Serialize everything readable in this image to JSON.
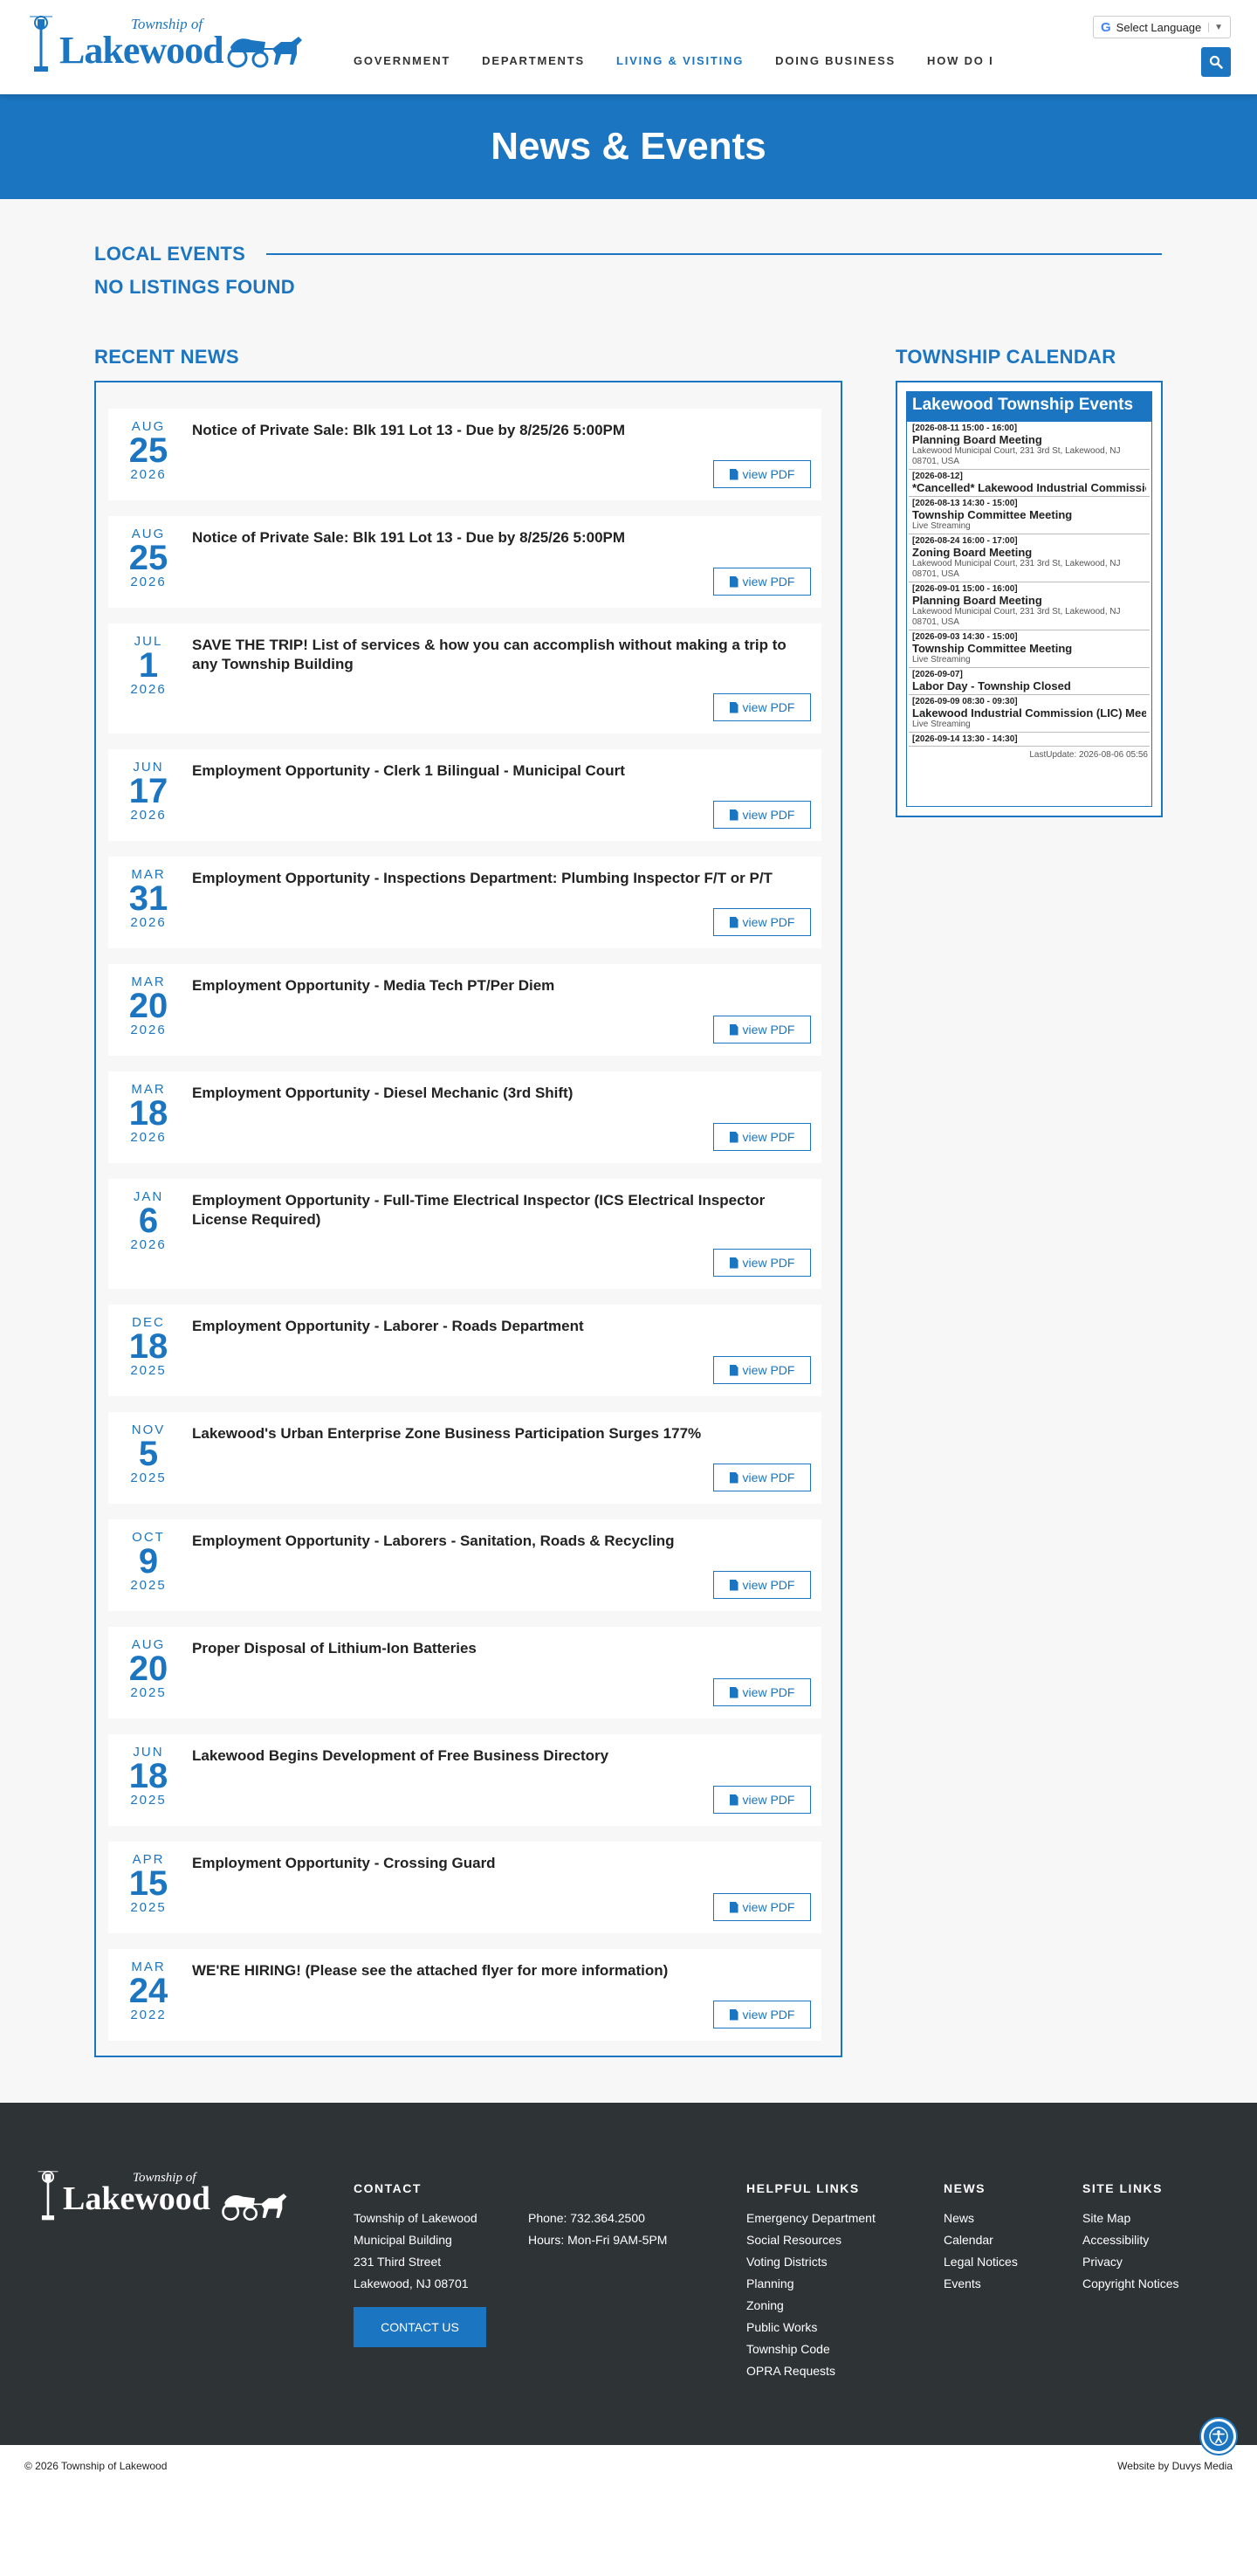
{
  "header": {
    "logo_small": "Township of",
    "logo_name": "Lakewood",
    "nav": [
      "GOVERNMENT",
      "DEPARTMENTS",
      "LIVING & VISITING",
      "DOING BUSINESS",
      "HOW DO I"
    ],
    "active_nav": "LIVING & VISITING",
    "language_label": "Select Language",
    "language_g": "G",
    "language_arrow": "▼"
  },
  "banner": {
    "title": "News & Events"
  },
  "local_events": {
    "title": "LOCAL EVENTS",
    "empty": "NO LISTINGS FOUND"
  },
  "recent_news": {
    "title": "RECENT NEWS",
    "button_label": "view PDF",
    "items": [
      {
        "mon": "AUG",
        "day": "25",
        "yr": "2026",
        "title": "Notice of Private Sale: Blk 191 Lot 13 - Due by 8/25/26 5:00PM"
      },
      {
        "mon": "AUG",
        "day": "25",
        "yr": "2026",
        "title": "Notice of Private Sale: Blk 191 Lot 13 - Due by 8/25/26 5:00PM"
      },
      {
        "mon": "JUL",
        "day": "1",
        "yr": "2026",
        "title": "SAVE THE TRIP! List of services & how you can accomplish without making a trip to any Township Building"
      },
      {
        "mon": "JUN",
        "day": "17",
        "yr": "2026",
        "title": "Employment Opportunity - Clerk 1 Bilingual - Municipal Court"
      },
      {
        "mon": "MAR",
        "day": "31",
        "yr": "2026",
        "title": "Employment Opportunity - Inspections Department: Plumbing Inspector F/T or P/T"
      },
      {
        "mon": "MAR",
        "day": "20",
        "yr": "2026",
        "title": "Employment Opportunity - Media Tech PT/Per Diem"
      },
      {
        "mon": "MAR",
        "day": "18",
        "yr": "2026",
        "title": "Employment Opportunity - Diesel Mechanic (3rd Shift)"
      },
      {
        "mon": "JAN",
        "day": "6",
        "yr": "2026",
        "title": "Employment Opportunity - Full-Time Electrical Inspector (ICS Electrical Inspector License Required)"
      },
      {
        "mon": "DEC",
        "day": "18",
        "yr": "2025",
        "title": "Employment Opportunity - Laborer - Roads Department"
      },
      {
        "mon": "NOV",
        "day": "5",
        "yr": "2025",
        "title": "Lakewood's Urban Enterprise Zone Business Participation Surges 177%"
      },
      {
        "mon": "OCT",
        "day": "9",
        "yr": "2025",
        "title": "Employment Opportunity - Laborers - Sanitation, Roads & Recycling"
      },
      {
        "mon": "AUG",
        "day": "20",
        "yr": "2025",
        "title": "Proper Disposal of Lithium-Ion Batteries"
      },
      {
        "mon": "JUN",
        "day": "18",
        "yr": "2025",
        "title": "Lakewood Begins Development of Free Business Directory"
      },
      {
        "mon": "APR",
        "day": "15",
        "yr": "2025",
        "title": "Employment Opportunity - Crossing Guard"
      },
      {
        "mon": "MAR",
        "day": "24",
        "yr": "2022",
        "title": "WE'RE HIRING! (Please see the attached flyer for more information)"
      }
    ]
  },
  "calendar": {
    "title": "TOWNSHIP CALENDAR",
    "widget_title": "Lakewood Township Events",
    "events": [
      {
        "dt": "[2026-08-11 15:00 - 16:00]",
        "title": "Planning Board Meeting",
        "loc": "Lakewood Municipal Court, 231 3rd St, Lakewood, NJ 08701, USA"
      },
      {
        "dt": "[2026-08-12]",
        "title": "*Cancelled* Lakewood Industrial Commission",
        "loc": ""
      },
      {
        "dt": "[2026-08-13 14:30 - 15:00]",
        "title": "Township Committee Meeting",
        "loc": "Live Streaming"
      },
      {
        "dt": "[2026-08-24 16:00 - 17:00]",
        "title": "Zoning Board Meeting",
        "loc": "Lakewood Municipal Court, 231 3rd St, Lakewood, NJ 08701, USA"
      },
      {
        "dt": "[2026-09-01 15:00 - 16:00]",
        "title": "Planning Board Meeting",
        "loc": "Lakewood Municipal Court, 231 3rd St, Lakewood, NJ 08701, USA"
      },
      {
        "dt": "[2026-09-03 14:30 - 15:00]",
        "title": "Township Committee Meeting",
        "loc": "Live Streaming"
      },
      {
        "dt": "[2026-09-07]",
        "title": "Labor Day - Township Closed",
        "loc": ""
      },
      {
        "dt": "[2026-09-09 08:30 - 09:30]",
        "title": "Lakewood Industrial Commission (LIC) Meeting",
        "loc": "Live Streaming"
      },
      {
        "dt": "[2026-09-14 13:30 - 14:30]",
        "title": "",
        "loc": ""
      }
    ],
    "last_update": "LastUpdate: 2026-08-06 05:56"
  },
  "footer": {
    "contact": {
      "heading": "CONTACT",
      "address": [
        "Township of Lakewood",
        "Municipal Building",
        "231 Third Street",
        "Lakewood, NJ 08701"
      ],
      "phone": "Phone: 732.364.2500",
      "hours": "Hours: Mon-Fri 9AM-5PM",
      "button": "CONTACT US"
    },
    "helpful": {
      "heading": "HELPFUL LINKS",
      "links": [
        "Emergency Department",
        "Social Resources",
        "Voting Districts",
        "Planning",
        "Zoning",
        "Public Works",
        "Township Code",
        "OPRA Requests"
      ]
    },
    "news": {
      "heading": "NEWS",
      "links": [
        "News",
        "Calendar",
        "Legal Notices",
        "Events"
      ]
    },
    "site": {
      "heading": "SITE LINKS",
      "links": [
        "Site Map",
        "Accessibility",
        "Privacy",
        "Copyright Notices"
      ]
    },
    "copyright": "© 2026 Township of Lakewood",
    "credit": "Website by Duvys Media"
  },
  "colors": {
    "brand": "#1b75c0",
    "footer_bg": "#2e3336",
    "page_bg": "#f7f7f7"
  }
}
